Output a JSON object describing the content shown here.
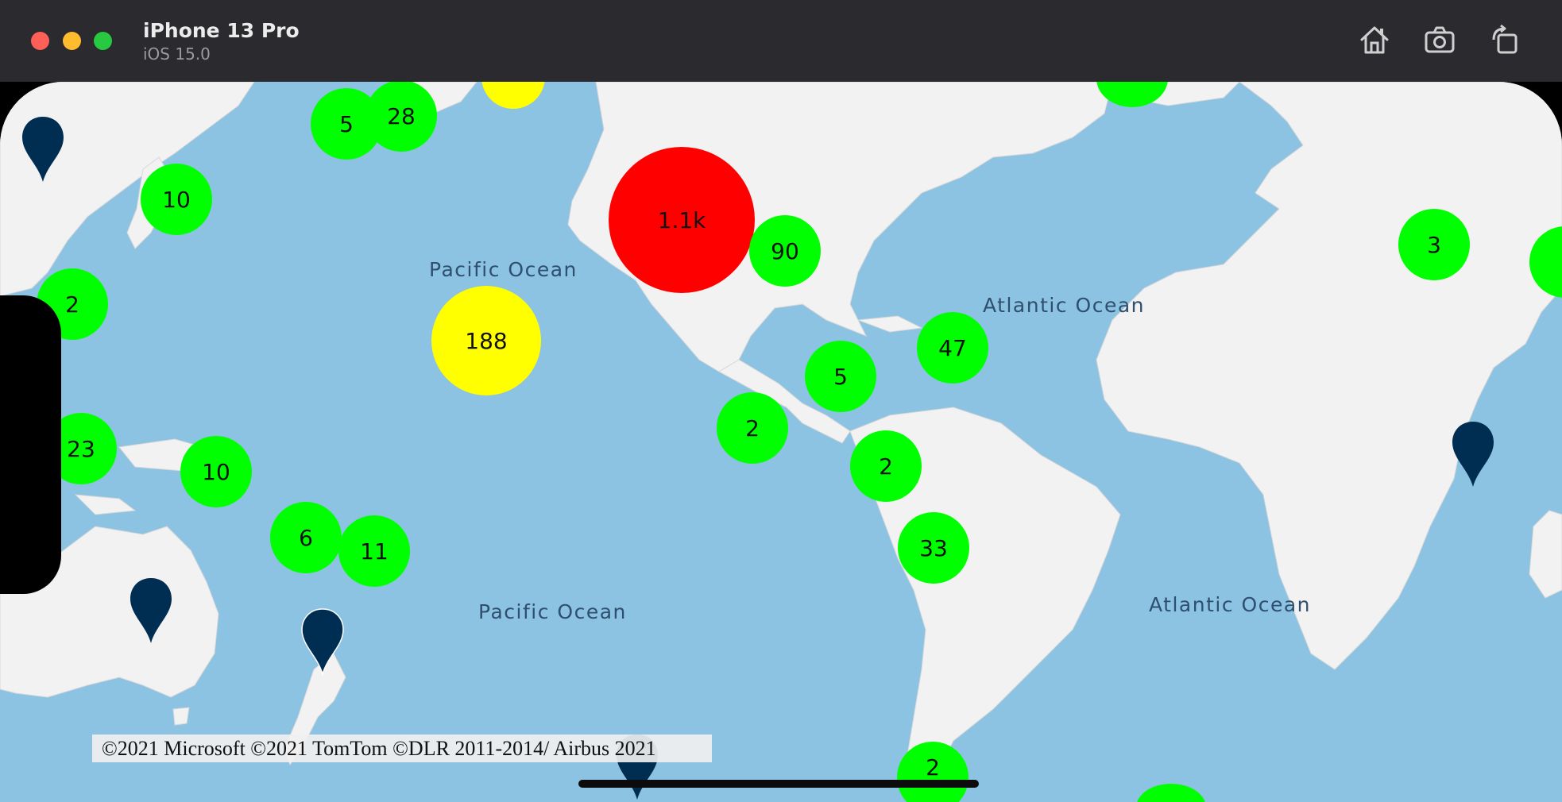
{
  "window": {
    "device_name": "iPhone 13 Pro",
    "os_version": "iOS 15.0",
    "toolbar_icons": [
      "home-icon",
      "screenshot-icon",
      "rotate-icon"
    ]
  },
  "map": {
    "ocean_labels": {
      "pacific_north": "Pacific Ocean",
      "pacific_south": "Pacific Ocean",
      "atlantic_north": "Atlantic Ocean",
      "atlantic_south": "Atlantic Ocean"
    },
    "clusters": {
      "c_5_japan_north": "5",
      "c_28": "28",
      "c_10_japan": "10",
      "c_2_asia": "2",
      "c_23": "23",
      "c_10_png": "10",
      "c_6": "6",
      "c_11": "11",
      "c_188": "188",
      "c_1_1k": "1.1k",
      "c_90": "90",
      "c_47": "47",
      "c_5_central_america": "5",
      "c_2_pacific_east": "2",
      "c_2_peru": "2",
      "c_33": "33",
      "c_3_mediterranean": "3",
      "c_2_bottom": "2"
    },
    "cluster_colors": {
      "small": "#00ff00",
      "medium": "#ffff00",
      "large": "#ff0000"
    },
    "pin_color": "#002d52",
    "copyright": "©2021 Microsoft ©2021 TomTom ©DLR 2011-2014/ Airbus 2021"
  }
}
